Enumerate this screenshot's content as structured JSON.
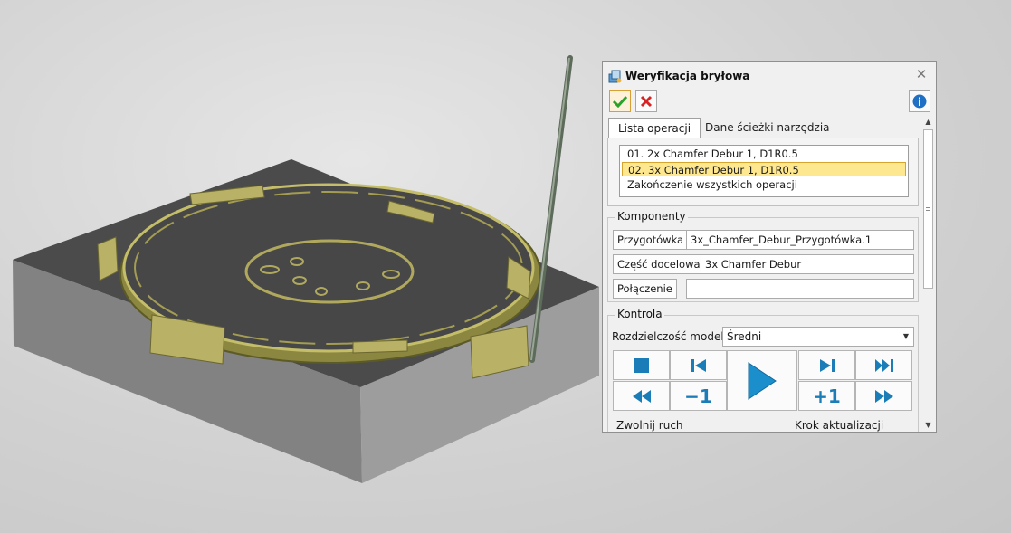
{
  "dialog": {
    "title": "Weryfikacja bryłowa",
    "close_glyph": "✕",
    "toolbar": {
      "ok_icon": "checkmark-icon",
      "cancel_icon": "red-x-icon",
      "info_icon": "info-icon"
    }
  },
  "tabs": [
    {
      "label": "Lista operacji",
      "active": true
    },
    {
      "label": "Dane ścieżki narzędzia",
      "active": false
    }
  ],
  "operations": [
    {
      "label": "01. 2x Chamfer Debur 1, D1R0.5",
      "selected": false
    },
    {
      "label": "02. 3x Chamfer Debur 1, D1R0.5",
      "selected": true
    },
    {
      "label": "Zakończenie wszystkich operacji",
      "selected": false
    }
  ],
  "komponenty": {
    "title": "Komponenty",
    "przygotowka": {
      "label": "Przygotówka",
      "value": "3x_Chamfer_Debur_Przygotówka.1"
    },
    "czesc": {
      "label": "Część docelowa",
      "value": "3x Chamfer Debur"
    },
    "polaczenie": {
      "label": "Połączenie",
      "value": ""
    }
  },
  "kontrola": {
    "title": "Kontrola",
    "resolution_label": "Rozdzielczość modelu",
    "resolution_value": "Średni",
    "minus_one": "−1",
    "plus_one": "+1",
    "slow_label": "Zwolnij ruch",
    "step_label": "Krok aktualizacji"
  },
  "colors": {
    "accent": "#1a7db8",
    "selection": "#fde78f",
    "part": "#aca65a",
    "stock": "#4a4a4a"
  }
}
